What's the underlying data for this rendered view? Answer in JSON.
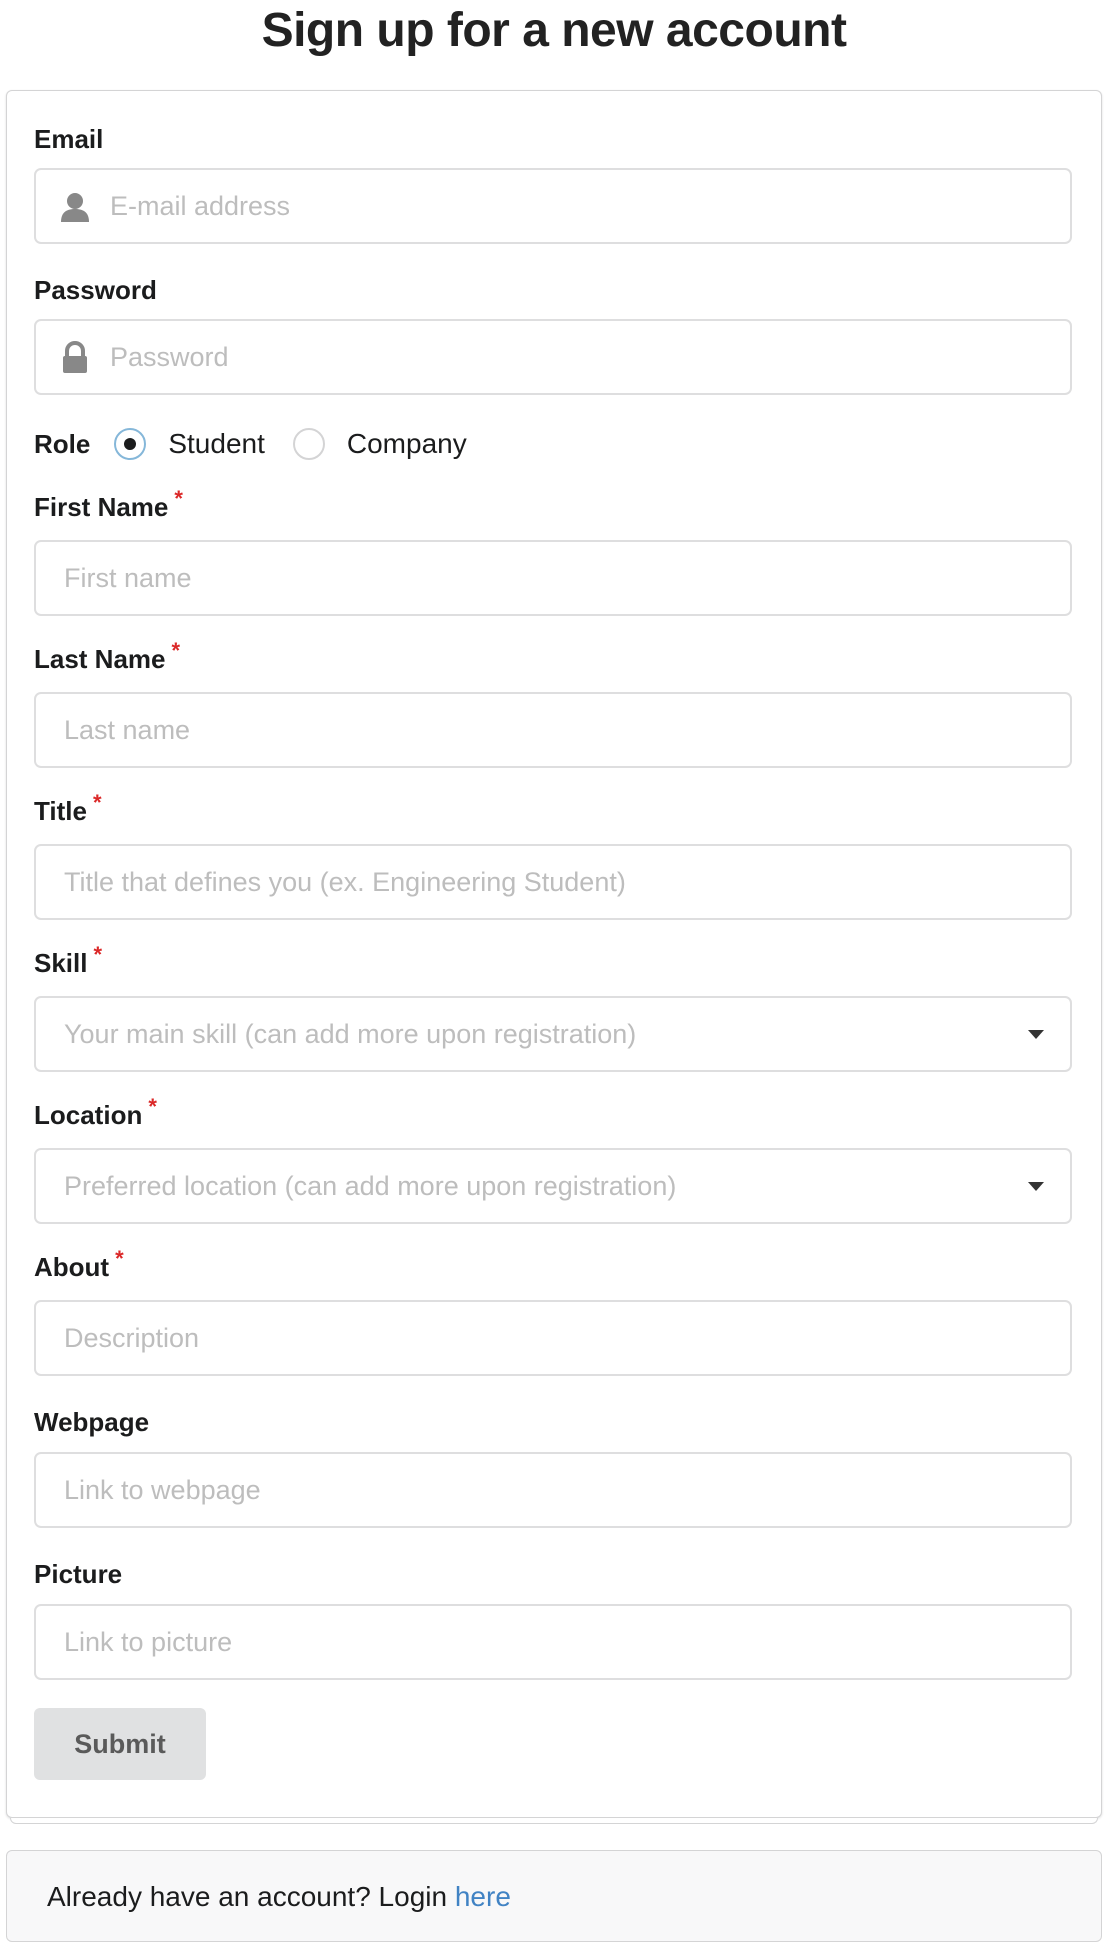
{
  "page": {
    "title": "Sign up for a new account"
  },
  "form": {
    "email": {
      "label": "Email",
      "placeholder": "E-mail address",
      "icon": "user-icon"
    },
    "password": {
      "label": "Password",
      "placeholder": "Password",
      "icon": "lock-icon"
    },
    "role": {
      "label": "Role",
      "options": [
        {
          "label": "Student",
          "checked": true
        },
        {
          "label": "Company",
          "checked": false
        }
      ]
    },
    "first_name": {
      "label": "First Name",
      "required_mark": "*",
      "placeholder": "First name"
    },
    "last_name": {
      "label": "Last Name",
      "required_mark": "*",
      "placeholder": "Last name"
    },
    "title": {
      "label": "Title",
      "required_mark": "*",
      "placeholder": "Title that defines you (ex. Engineering Student)"
    },
    "skill": {
      "label": "Skill",
      "required_mark": "*",
      "placeholder": "Your main skill (can add more upon registration)"
    },
    "location": {
      "label": "Location",
      "required_mark": "*",
      "placeholder": "Preferred location (can add more upon registration)"
    },
    "about": {
      "label": "About",
      "required_mark": "*",
      "placeholder": "Description"
    },
    "webpage": {
      "label": "Webpage",
      "placeholder": "Link to webpage"
    },
    "picture": {
      "label": "Picture",
      "placeholder": "Link to picture"
    },
    "submit_label": "Submit"
  },
  "login": {
    "text": "Already have an account? Login ",
    "link_text": "here"
  },
  "colors": {
    "required": "#db2828",
    "link": "#4183c4",
    "placeholder": "#bdbdbd"
  }
}
